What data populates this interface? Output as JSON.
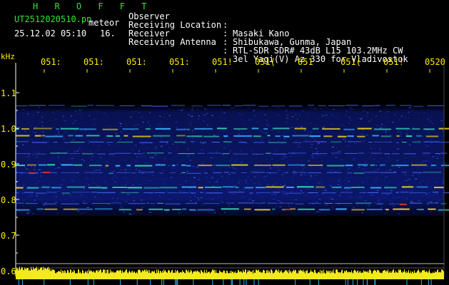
{
  "app": {
    "title": "H R O F F T",
    "filename": "UT2512020510.pn",
    "mode": "meteor",
    "datetime": "25.12.02 05:10",
    "index": "16."
  },
  "header": [
    {
      "label": "Observer",
      "value": "Masaki Kano"
    },
    {
      "label": "Receiving Location",
      "value": "Shibukawa, Gunma, Japan"
    },
    {
      "label": "Receiver",
      "value": "RTL-SDR SDR# 43dB L15 103.2MHz CW"
    },
    {
      "label": "Receiving Antenna",
      "value": "3el Yagi(V) Az 330 for Vladivostok"
    }
  ],
  "axis": {
    "unit": "kHz",
    "y_ticks": [
      "1.1",
      "1.0",
      "0.9",
      "0.8",
      "0.7",
      "0.6"
    ],
    "x_ticks": [
      "051:",
      "051:",
      "051:",
      "051:",
      "051!",
      "051(",
      "051",
      "051(",
      "051!",
      "0520"
    ]
  },
  "colors": {
    "text_primary": "#33e633",
    "text_secondary": "#ffffff",
    "tick_labels": "#ffee00",
    "background": "#000000",
    "signal_noise": "#0a1eb4",
    "signal_strong": "#e6d21e"
  }
}
